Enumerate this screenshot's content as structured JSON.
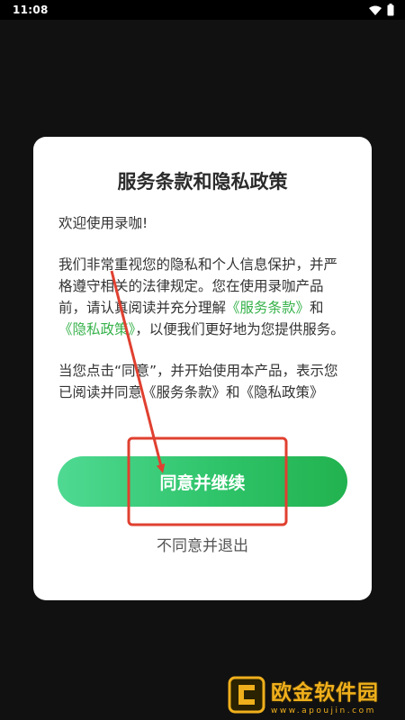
{
  "status_bar": {
    "time": "11:08"
  },
  "dialog": {
    "title": "服务条款和隐私政策",
    "greeting": "欢迎使用录咖!",
    "paragraph1": {
      "part1": "我们非常重视您的隐私和个人信息保护，并严格遵守相关的法律规定。您在使用录咖产品前，请认真阅读并充分理解",
      "link_terms": "《服务条款》",
      "part2": "和",
      "link_privacy": "《隐私政策》",
      "part3": "，以便我们更好地为您提供服务。"
    },
    "paragraph2": "当您点击“同意”，并开始使用本产品，表示您已阅读并同意《服务条款》和《隐私政策》",
    "agree_label": "同意并继续",
    "disagree_label": "不同意并退出"
  },
  "watermark": {
    "name": "欧金软件园",
    "url": "www.apoujin.com"
  },
  "colors": {
    "link": "#36b24a",
    "button_start": "#4fd992",
    "button_end": "#22b24f",
    "annotation": "#e04030"
  },
  "icons": {
    "wifi": "wifi-icon",
    "battery": "battery-icon",
    "logo": "watermark-logo-icon"
  }
}
